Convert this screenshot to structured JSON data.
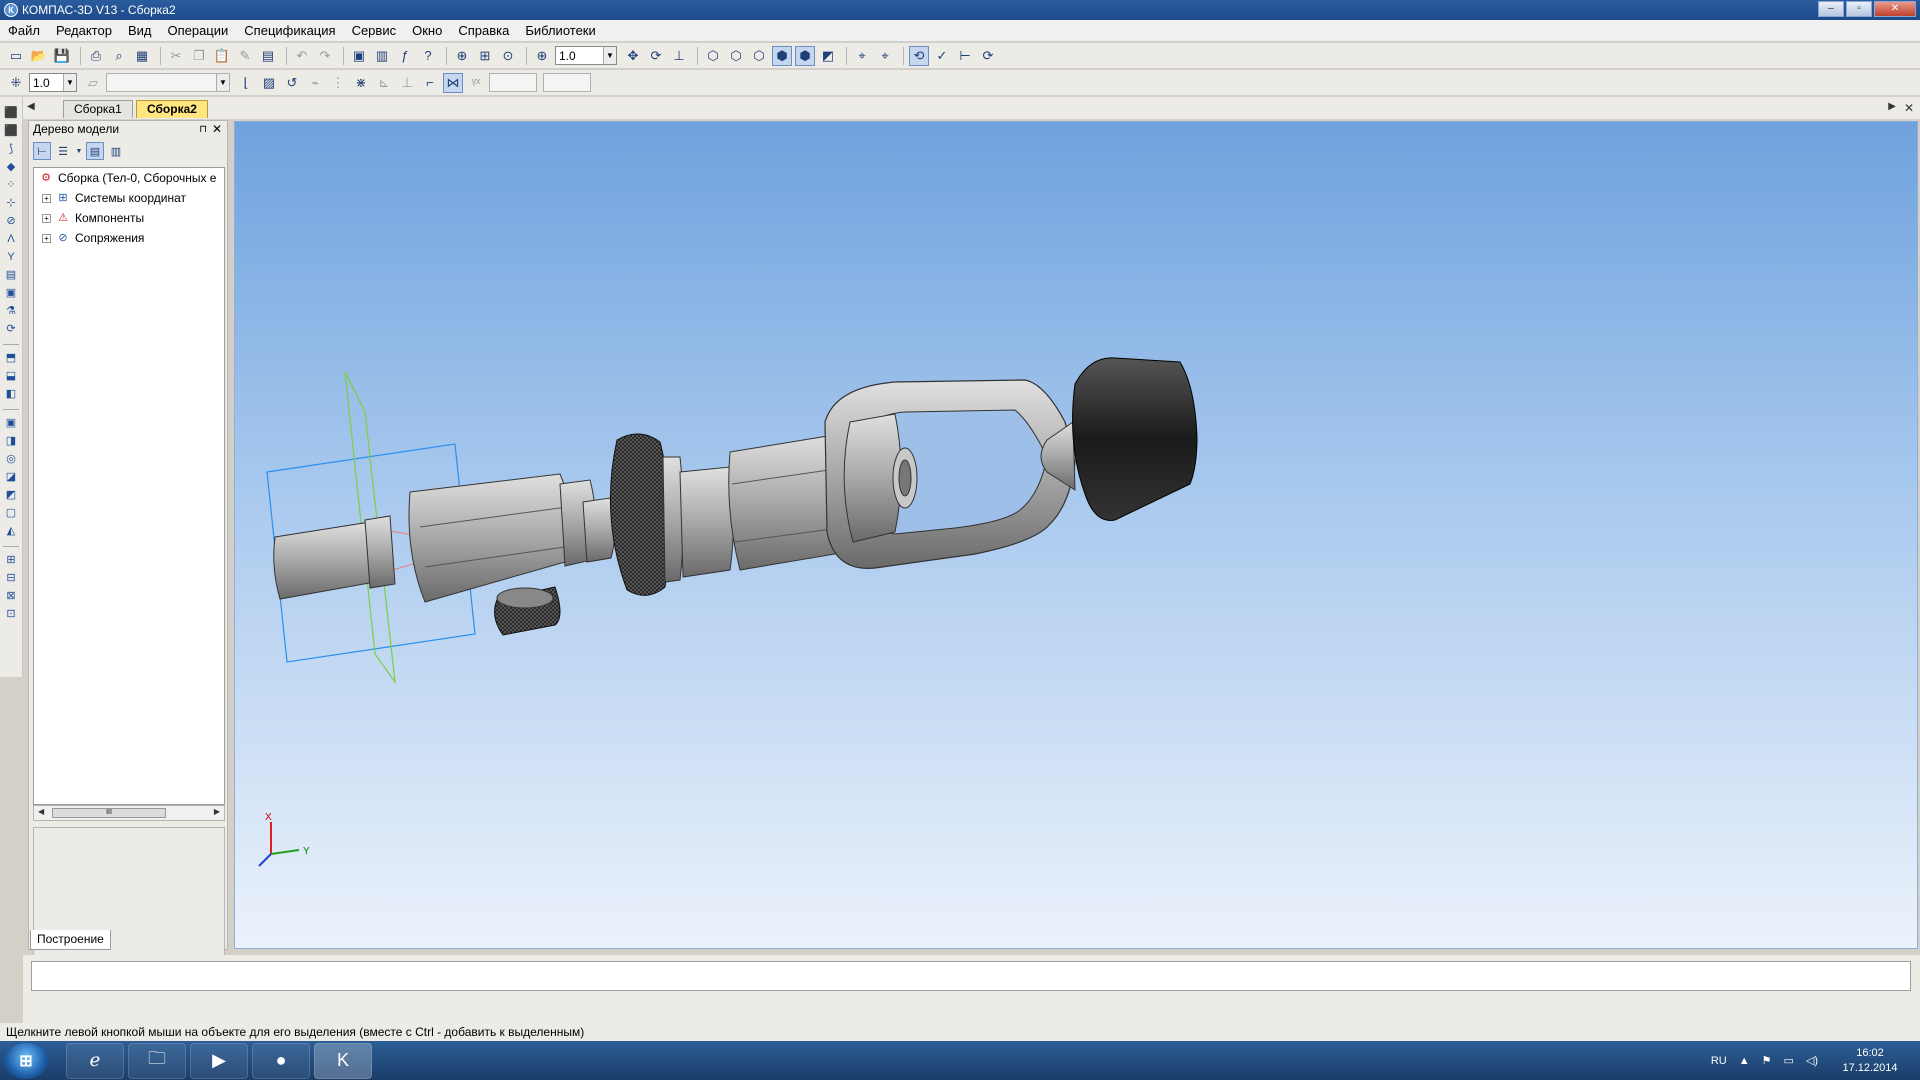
{
  "window": {
    "title": "КОМПАС-3D V13 - Сборка2",
    "app_icon_letter": "К",
    "minimize": "–",
    "maximize": "▫",
    "close": "✕"
  },
  "menu": [
    "Файл",
    "Редактор",
    "Вид",
    "Операции",
    "Спецификация",
    "Сервис",
    "Окно",
    "Справка",
    "Библиотеки"
  ],
  "toolbar1": {
    "zoom_value": "1.0"
  },
  "toolbar2": {
    "step_value": "1.0",
    "style_value": ""
  },
  "doc_tabs": {
    "tabs": [
      "Сборка1",
      "Сборка2"
    ],
    "active": "Сборка2"
  },
  "model_tree": {
    "title": "Дерево модели",
    "pin": "⊓",
    "close": "✕",
    "root": "Сборка (Тел-0, Сборочных е",
    "items": [
      "Системы координат",
      "Компоненты",
      "Сопряжения"
    ],
    "scroll_thumb": "III",
    "bottom_tab": "Построение"
  },
  "viewport": {
    "axis_x": "X",
    "axis_y": "Y"
  },
  "command_line": "",
  "status_text": "Щелкните левой кнопкой мыши на объекте для его выделения (вместе с Ctrl - добавить к выделенным)",
  "taskbar": {
    "language": "RU",
    "time": "16:02",
    "date": "17.12.2014"
  },
  "colors": {
    "viewport_top": "#6fa2de",
    "viewport_bottom": "#ecf2fb",
    "active_tab": "#ffe680",
    "part_gray": "#9a9a9a",
    "handle_black": "#111111"
  }
}
